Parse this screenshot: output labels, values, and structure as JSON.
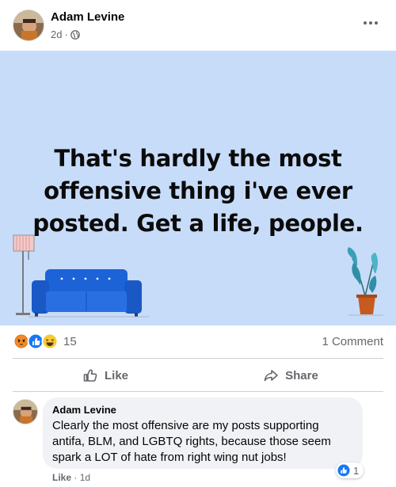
{
  "post": {
    "author": "Adam Levine",
    "time": "2d",
    "separator": "·",
    "card_text": "That's hardly the most offensive thing i've ever posted. Get a life, people.",
    "card_background": "#c7dcf9"
  },
  "reactions": {
    "icons": [
      "angry-icon",
      "like-icon",
      "haha-icon"
    ],
    "count": "15",
    "comments": "1 Comment"
  },
  "actions": {
    "like": "Like",
    "share": "Share"
  },
  "comment": {
    "author": "Adam Levine",
    "text": "Clearly the most offensive are my posts supporting antifa, BLM, and LGBTQ rights, because those seem spark a LOT of hate from right wing nut jobs!",
    "reaction_count": "1",
    "like": "Like",
    "separator": "·",
    "time": "1d"
  },
  "colors": {
    "accent": "#1877f2",
    "muted": "#65676b",
    "sofa": "#1d63d8"
  }
}
